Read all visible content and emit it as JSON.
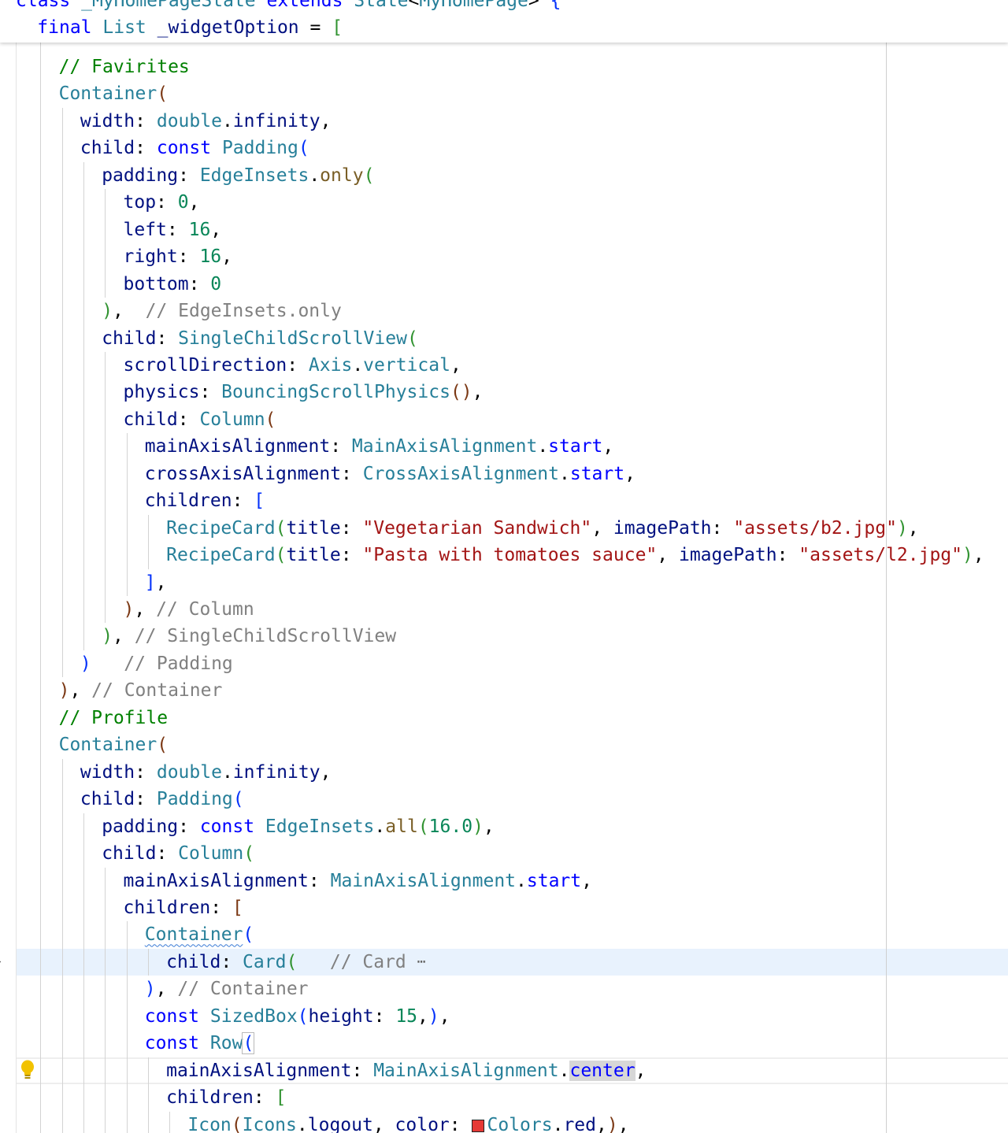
{
  "editor": {
    "sticky_lines": [
      {
        "indent": 0,
        "tokens": [
          {
            "t": "class ",
            "c": "kw"
          },
          {
            "t": "_MyHomePageState ",
            "c": "type"
          },
          {
            "t": "extends ",
            "c": "kw"
          },
          {
            "t": "State",
            "c": "type"
          },
          {
            "t": "<",
            "c": "punc"
          },
          {
            "t": "MyHomePage",
            "c": "type"
          },
          {
            "t": "> ",
            "c": "punc"
          },
          {
            "t": "{",
            "c": "b1"
          }
        ]
      },
      {
        "indent": 1,
        "tokens": [
          {
            "t": "final ",
            "c": "kw"
          },
          {
            "t": "List ",
            "c": "type"
          },
          {
            "t": "_widgetOption",
            "c": "prop"
          },
          {
            "t": " = ",
            "c": "punc"
          },
          {
            "t": "[",
            "c": "b2"
          }
        ]
      }
    ],
    "lines": [
      {
        "indent": 2,
        "tokens": [
          {
            "t": "// Favirites",
            "c": "cmt2"
          }
        ]
      },
      {
        "indent": 2,
        "tokens": [
          {
            "t": "Container",
            "c": "type"
          },
          {
            "t": "(",
            "c": "b3"
          }
        ]
      },
      {
        "indent": 3,
        "tokens": [
          {
            "t": "width",
            "c": "prop"
          },
          {
            "t": ": ",
            "c": "punc"
          },
          {
            "t": "double",
            "c": "type"
          },
          {
            "t": ".",
            "c": "punc"
          },
          {
            "t": "infinity",
            "c": "prop"
          },
          {
            "t": ",",
            "c": "punc"
          }
        ]
      },
      {
        "indent": 3,
        "tokens": [
          {
            "t": "child",
            "c": "prop"
          },
          {
            "t": ": ",
            "c": "punc"
          },
          {
            "t": "const ",
            "c": "kw"
          },
          {
            "t": "Padding",
            "c": "type"
          },
          {
            "t": "(",
            "c": "b1"
          }
        ]
      },
      {
        "indent": 4,
        "tokens": [
          {
            "t": "padding",
            "c": "prop"
          },
          {
            "t": ": ",
            "c": "punc"
          },
          {
            "t": "EdgeInsets",
            "c": "type"
          },
          {
            "t": ".",
            "c": "punc"
          },
          {
            "t": "only",
            "c": "method"
          },
          {
            "t": "(",
            "c": "b2"
          }
        ]
      },
      {
        "indent": 5,
        "tokens": [
          {
            "t": "top",
            "c": "prop"
          },
          {
            "t": ": ",
            "c": "punc"
          },
          {
            "t": "0",
            "c": "num"
          },
          {
            "t": ",",
            "c": "punc"
          }
        ]
      },
      {
        "indent": 5,
        "tokens": [
          {
            "t": "left",
            "c": "prop"
          },
          {
            "t": ": ",
            "c": "punc"
          },
          {
            "t": "16",
            "c": "num"
          },
          {
            "t": ",",
            "c": "punc"
          }
        ]
      },
      {
        "indent": 5,
        "tokens": [
          {
            "t": "right",
            "c": "prop"
          },
          {
            "t": ": ",
            "c": "punc"
          },
          {
            "t": "16",
            "c": "num"
          },
          {
            "t": ",",
            "c": "punc"
          }
        ]
      },
      {
        "indent": 5,
        "tokens": [
          {
            "t": "bottom",
            "c": "prop"
          },
          {
            "t": ": ",
            "c": "punc"
          },
          {
            "t": "0",
            "c": "num"
          }
        ]
      },
      {
        "indent": 4,
        "tokens": [
          {
            "t": ")",
            "c": "b2"
          },
          {
            "t": ",  ",
            "c": "punc"
          },
          {
            "t": "// EdgeInsets.only",
            "c": "cmt"
          }
        ]
      },
      {
        "indent": 4,
        "tokens": [
          {
            "t": "child",
            "c": "prop"
          },
          {
            "t": ": ",
            "c": "punc"
          },
          {
            "t": "SingleChildScrollView",
            "c": "type"
          },
          {
            "t": "(",
            "c": "b2"
          }
        ]
      },
      {
        "indent": 5,
        "tokens": [
          {
            "t": "scrollDirection",
            "c": "prop"
          },
          {
            "t": ": ",
            "c": "punc"
          },
          {
            "t": "Axis",
            "c": "type"
          },
          {
            "t": ".",
            "c": "punc"
          },
          {
            "t": "vertical",
            "c": "type"
          },
          {
            "t": ",",
            "c": "punc"
          }
        ]
      },
      {
        "indent": 5,
        "tokens": [
          {
            "t": "physics",
            "c": "prop"
          },
          {
            "t": ": ",
            "c": "punc"
          },
          {
            "t": "BouncingScrollPhysics",
            "c": "type"
          },
          {
            "t": "()",
            "c": "b3"
          },
          {
            "t": ",",
            "c": "punc"
          }
        ]
      },
      {
        "indent": 5,
        "tokens": [
          {
            "t": "child",
            "c": "prop"
          },
          {
            "t": ": ",
            "c": "punc"
          },
          {
            "t": "Column",
            "c": "type"
          },
          {
            "t": "(",
            "c": "b3"
          }
        ]
      },
      {
        "indent": 6,
        "tokens": [
          {
            "t": "mainAxisAlignment",
            "c": "prop"
          },
          {
            "t": ": ",
            "c": "punc"
          },
          {
            "t": "MainAxisAlignment",
            "c": "type"
          },
          {
            "t": ".",
            "c": "punc"
          },
          {
            "t": "start",
            "c": "kw"
          },
          {
            "t": ",",
            "c": "punc"
          }
        ]
      },
      {
        "indent": 6,
        "tokens": [
          {
            "t": "crossAxisAlignment",
            "c": "prop"
          },
          {
            "t": ": ",
            "c": "punc"
          },
          {
            "t": "CrossAxisAlignment",
            "c": "type"
          },
          {
            "t": ".",
            "c": "punc"
          },
          {
            "t": "start",
            "c": "kw"
          },
          {
            "t": ",",
            "c": "punc"
          }
        ]
      },
      {
        "indent": 6,
        "tokens": [
          {
            "t": "children",
            "c": "prop"
          },
          {
            "t": ": ",
            "c": "punc"
          },
          {
            "t": "[",
            "c": "b1"
          }
        ]
      },
      {
        "indent": 7,
        "tokens": [
          {
            "t": "RecipeCard",
            "c": "type"
          },
          {
            "t": "(",
            "c": "b2"
          },
          {
            "t": "title",
            "c": "prop"
          },
          {
            "t": ": ",
            "c": "punc"
          },
          {
            "t": "\"Vegetarian Sandwich\"",
            "c": "str"
          },
          {
            "t": ", ",
            "c": "punc"
          },
          {
            "t": "imagePath",
            "c": "prop"
          },
          {
            "t": ": ",
            "c": "punc"
          },
          {
            "t": "\"assets/b2.jpg\"",
            "c": "str"
          },
          {
            "t": ")",
            "c": "b2"
          },
          {
            "t": ",",
            "c": "punc"
          }
        ]
      },
      {
        "indent": 7,
        "tokens": [
          {
            "t": "RecipeCard",
            "c": "type"
          },
          {
            "t": "(",
            "c": "b2"
          },
          {
            "t": "title",
            "c": "prop"
          },
          {
            "t": ": ",
            "c": "punc"
          },
          {
            "t": "\"Pasta with tomatoes sauce\"",
            "c": "str"
          },
          {
            "t": ", ",
            "c": "punc"
          },
          {
            "t": "imagePath",
            "c": "prop"
          },
          {
            "t": ": ",
            "c": "punc"
          },
          {
            "t": "\"assets/l2.jpg\"",
            "c": "str"
          },
          {
            "t": ")",
            "c": "b2"
          },
          {
            "t": ",",
            "c": "punc"
          }
        ]
      },
      {
        "indent": 6,
        "tokens": [
          {
            "t": "]",
            "c": "b1"
          },
          {
            "t": ",",
            "c": "punc"
          }
        ]
      },
      {
        "indent": 5,
        "tokens": [
          {
            "t": ")",
            "c": "b3"
          },
          {
            "t": ", ",
            "c": "punc"
          },
          {
            "t": "// Column",
            "c": "cmt"
          }
        ]
      },
      {
        "indent": 4,
        "tokens": [
          {
            "t": ")",
            "c": "b2"
          },
          {
            "t": ", ",
            "c": "punc"
          },
          {
            "t": "// SingleChildScrollView",
            "c": "cmt"
          }
        ]
      },
      {
        "indent": 3,
        "tokens": [
          {
            "t": ")",
            "c": "b1"
          },
          {
            "t": "   ",
            "c": "punc"
          },
          {
            "t": "// Padding",
            "c": "cmt"
          }
        ]
      },
      {
        "indent": 2,
        "tokens": [
          {
            "t": ")",
            "c": "b3"
          },
          {
            "t": ", ",
            "c": "punc"
          },
          {
            "t": "// Container",
            "c": "cmt"
          }
        ]
      },
      {
        "indent": 2,
        "tokens": [
          {
            "t": "// Profile",
            "c": "cmt2"
          }
        ]
      },
      {
        "indent": 2,
        "tokens": [
          {
            "t": "Container",
            "c": "type"
          },
          {
            "t": "(",
            "c": "b3"
          }
        ]
      },
      {
        "indent": 3,
        "tokens": [
          {
            "t": "width",
            "c": "prop"
          },
          {
            "t": ": ",
            "c": "punc"
          },
          {
            "t": "double",
            "c": "type"
          },
          {
            "t": ".",
            "c": "punc"
          },
          {
            "t": "infinity",
            "c": "prop"
          },
          {
            "t": ",",
            "c": "punc"
          }
        ]
      },
      {
        "indent": 3,
        "tokens": [
          {
            "t": "child",
            "c": "prop"
          },
          {
            "t": ": ",
            "c": "punc"
          },
          {
            "t": "Padding",
            "c": "type"
          },
          {
            "t": "(",
            "c": "b1"
          }
        ]
      },
      {
        "indent": 4,
        "tokens": [
          {
            "t": "padding",
            "c": "prop"
          },
          {
            "t": ": ",
            "c": "punc"
          },
          {
            "t": "const ",
            "c": "kw"
          },
          {
            "t": "EdgeInsets",
            "c": "type"
          },
          {
            "t": ".",
            "c": "punc"
          },
          {
            "t": "all",
            "c": "method"
          },
          {
            "t": "(",
            "c": "b2"
          },
          {
            "t": "16.0",
            "c": "num"
          },
          {
            "t": ")",
            "c": "b2"
          },
          {
            "t": ",",
            "c": "punc"
          }
        ]
      },
      {
        "indent": 4,
        "tokens": [
          {
            "t": "child",
            "c": "prop"
          },
          {
            "t": ": ",
            "c": "punc"
          },
          {
            "t": "Column",
            "c": "type"
          },
          {
            "t": "(",
            "c": "b2"
          }
        ]
      },
      {
        "indent": 5,
        "tokens": [
          {
            "t": "mainAxisAlignment",
            "c": "prop"
          },
          {
            "t": ": ",
            "c": "punc"
          },
          {
            "t": "MainAxisAlignment",
            "c": "type"
          },
          {
            "t": ".",
            "c": "punc"
          },
          {
            "t": "start",
            "c": "kw"
          },
          {
            "t": ",",
            "c": "punc"
          }
        ]
      },
      {
        "indent": 5,
        "tokens": [
          {
            "t": "children",
            "c": "prop"
          },
          {
            "t": ": ",
            "c": "punc"
          },
          {
            "t": "[",
            "c": "b3"
          }
        ]
      },
      {
        "indent": 6,
        "tokens": [
          {
            "t": "Container",
            "c": "type",
            "squiggle": true
          },
          {
            "t": "(",
            "c": "b1"
          }
        ]
      },
      {
        "indent": 7,
        "tokens": [
          {
            "t": "child",
            "c": "prop"
          },
          {
            "t": ": ",
            "c": "punc"
          },
          {
            "t": "Card",
            "c": "type"
          },
          {
            "t": "(",
            "c": "b2"
          },
          {
            "t": "   ",
            "c": "punc"
          },
          {
            "t": "// Card ",
            "c": "cmt"
          },
          {
            "t": "⋯",
            "c": "ellipsis"
          }
        ]
      },
      {
        "indent": 6,
        "tokens": [
          {
            "t": ")",
            "c": "b1"
          },
          {
            "t": ", ",
            "c": "punc"
          },
          {
            "t": "// Container",
            "c": "cmt"
          }
        ]
      },
      {
        "indent": 6,
        "tokens": [
          {
            "t": "const ",
            "c": "kw"
          },
          {
            "t": "SizedBox",
            "c": "type"
          },
          {
            "t": "(",
            "c": "b1"
          },
          {
            "t": "height",
            "c": "prop"
          },
          {
            "t": ": ",
            "c": "punc"
          },
          {
            "t": "15",
            "c": "num"
          },
          {
            "t": ",",
            "c": "punc"
          },
          {
            "t": ")",
            "c": "b1"
          },
          {
            "t": ",",
            "c": "punc"
          }
        ]
      },
      {
        "indent": 6,
        "tokens": [
          {
            "t": "const ",
            "c": "kw"
          },
          {
            "t": "Row",
            "c": "type"
          },
          {
            "t": "(",
            "c": "b1",
            "box": true
          }
        ]
      },
      {
        "indent": 7,
        "tokens": [
          {
            "t": "mainAxisAlignment",
            "c": "prop"
          },
          {
            "t": ": ",
            "c": "punc"
          },
          {
            "t": "MainAxisAlignment",
            "c": "type"
          },
          {
            "t": ".",
            "c": "punc"
          },
          {
            "t": "center",
            "c": "kw",
            "sel": true
          },
          {
            "t": ",",
            "c": "punc"
          }
        ]
      },
      {
        "indent": 7,
        "tokens": [
          {
            "t": "children",
            "c": "prop"
          },
          {
            "t": ": ",
            "c": "punc"
          },
          {
            "t": "[",
            "c": "b2"
          }
        ]
      },
      {
        "indent": 8,
        "tokens": [
          {
            "t": "Icon",
            "c": "type"
          },
          {
            "t": "(",
            "c": "b3"
          },
          {
            "t": "Icons",
            "c": "type"
          },
          {
            "t": ".",
            "c": "punc"
          },
          {
            "t": "logout",
            "c": "prop"
          },
          {
            "t": ", ",
            "c": "punc"
          },
          {
            "t": "color",
            "c": "prop"
          },
          {
            "t": ": ",
            "c": "punc"
          },
          {
            "t": "",
            "c": "swatch"
          },
          {
            "t": "Colors",
            "c": "type"
          },
          {
            "t": ".",
            "c": "punc"
          },
          {
            "t": "red",
            "c": "prop"
          },
          {
            "t": ",",
            "c": "punc"
          },
          {
            "t": ")",
            "c": "b3"
          },
          {
            "t": ",",
            "c": "punc"
          }
        ]
      }
    ],
    "swatch_color": "#e53935",
    "icons": [
      "lightbulb-icon",
      "fold-arrow-icon"
    ]
  }
}
